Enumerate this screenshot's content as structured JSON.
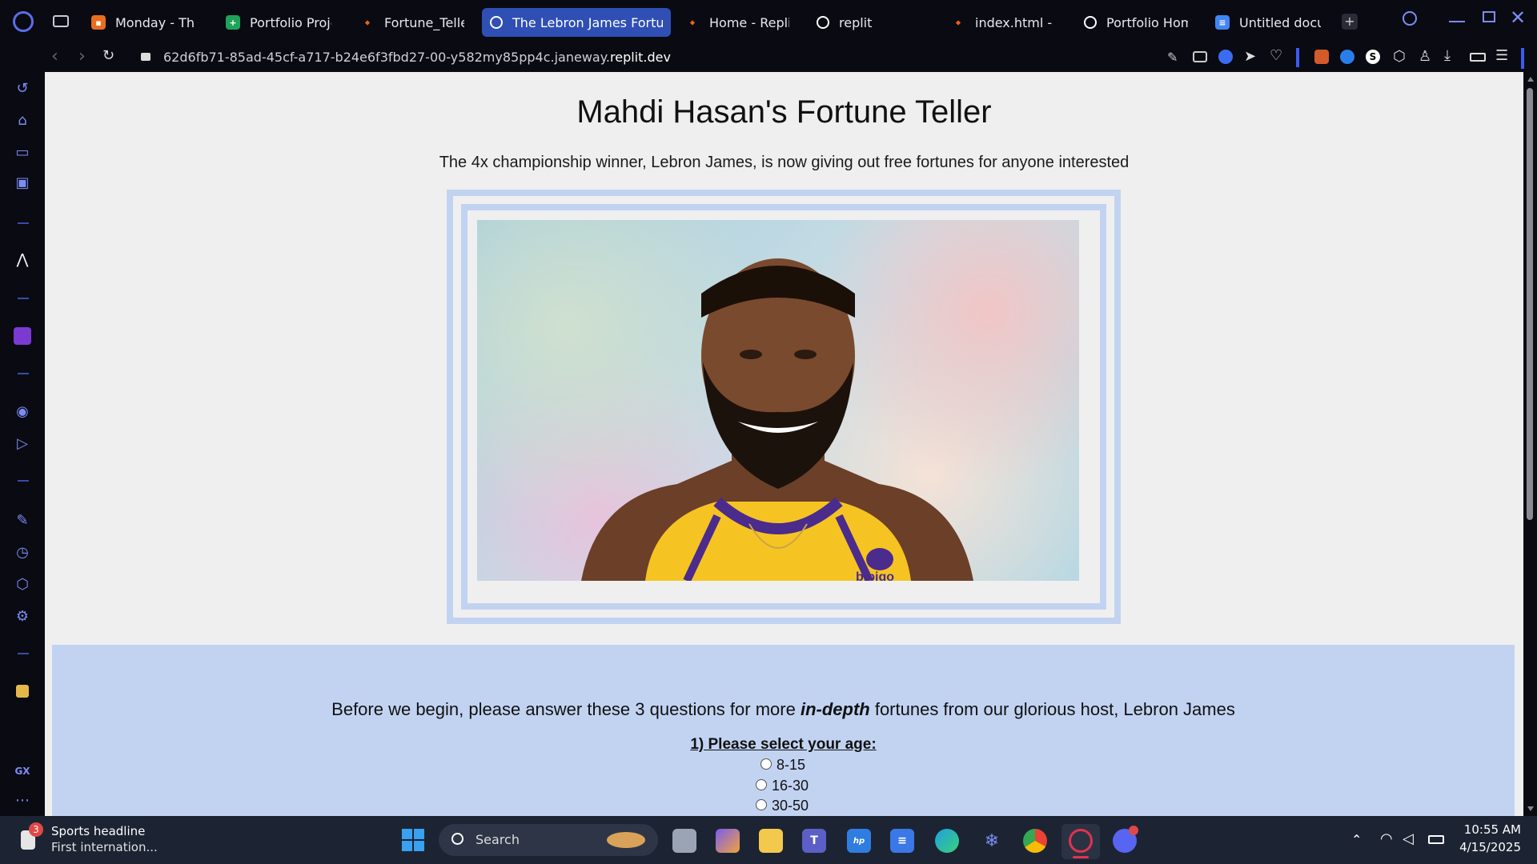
{
  "browser": {
    "tabs": [
      {
        "label": "Monday - Thurs",
        "active": false,
        "color": "#e86d1f"
      },
      {
        "label": "Portfolio Project",
        "active": false,
        "color": "#1fa35a"
      },
      {
        "label": "Fortune_Teller_",
        "active": false,
        "color": "#f26207"
      },
      {
        "label": "The Lebron James Fortune",
        "active": true,
        "color": "#ffffff"
      },
      {
        "label": "Home - Replit",
        "active": false,
        "color": "#f26207"
      },
      {
        "label": "replit",
        "active": false,
        "color": "#ffffff"
      },
      {
        "label": "index.html - Ma",
        "active": false,
        "color": "#f26207"
      },
      {
        "label": "Portfolio Home",
        "active": false,
        "color": "#ffffff"
      },
      {
        "label": "Untitled docum",
        "active": false,
        "color": "#4285f4"
      }
    ],
    "url_prefix": "62d6fb71-85ad-45cf-a717-b24e6f3fbd27-00-y582my85pp4c.janeway.",
    "url_domain": "replit.dev",
    "sidebar_label": "GX",
    "sidebar_more": "⋯"
  },
  "page": {
    "title": "Mahdi Hasan's Fortune Teller",
    "subtitle": "The 4x championship winner, Lebron James, is now giving out free fortunes for anyone interested",
    "image_caption": "bibigo",
    "questions_intro_pre": "Before we begin, please answer these 3 questions for more ",
    "questions_intro_em": "in-depth",
    "questions_intro_post": " fortunes from our glorious host, Lebron James",
    "question1": "1) Please select your age:",
    "age_options": [
      "8-15",
      "16-30",
      "30-50"
    ]
  },
  "taskbar": {
    "news_badge": "3",
    "news_title": "Sports headline",
    "news_sub": "First internation...",
    "search_label": "Search",
    "time": "10:55 AM",
    "date": "4/15/2025"
  },
  "colors": {
    "accent": "#2f4fb5",
    "frame": "#c2d3f2",
    "panel": "#c2d3f2",
    "sidebar_icon": "#7c8cf5"
  }
}
